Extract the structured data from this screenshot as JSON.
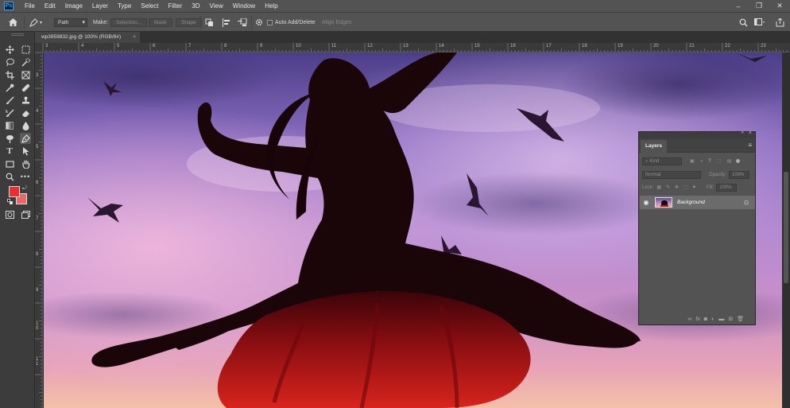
{
  "app": {
    "logo_text": "Ps"
  },
  "menu": [
    "File",
    "Edit",
    "Image",
    "Layer",
    "Type",
    "Select",
    "Filter",
    "3D",
    "View",
    "Window",
    "Help"
  ],
  "window_controls": {
    "minimize": "–",
    "restore": "❐",
    "close": "✕"
  },
  "options_bar": {
    "pick_mode": "Path",
    "make_label": "Make:",
    "selection_button": "Selection...",
    "mask_button": "Mask",
    "shape_button": "Shape",
    "auto_add_delete": "Auto Add/Delete",
    "align_edges": "Align Edges"
  },
  "document": {
    "tab_title": "wp3959832.jpg @ 100% (RGB/8#)",
    "close": "×"
  },
  "rulers": {
    "h_labels": [
      "3",
      "4",
      "5",
      "6",
      "7",
      "8",
      "9",
      "10",
      "11",
      "12",
      "13",
      "14",
      "15",
      "16",
      "17",
      "18",
      "19",
      "20",
      "21",
      "22",
      "23"
    ],
    "v_labels": [
      "3",
      "4",
      "5",
      "6",
      "7",
      "8",
      "9",
      "1 0",
      "1 1"
    ]
  },
  "colors": {
    "foreground": "#e8312d",
    "background": "#e86868"
  },
  "layers_panel": {
    "tab_label": "Layers",
    "kind_placeholder": "Kind",
    "blend_mode": "Normal",
    "opacity_label": "Opacity:",
    "opacity_value": "100%",
    "lock_label": "Lock:",
    "fill_label": "Fill:",
    "fill_value": "100%",
    "layers": [
      {
        "name": "Background",
        "visible": true,
        "locked": true
      }
    ]
  }
}
